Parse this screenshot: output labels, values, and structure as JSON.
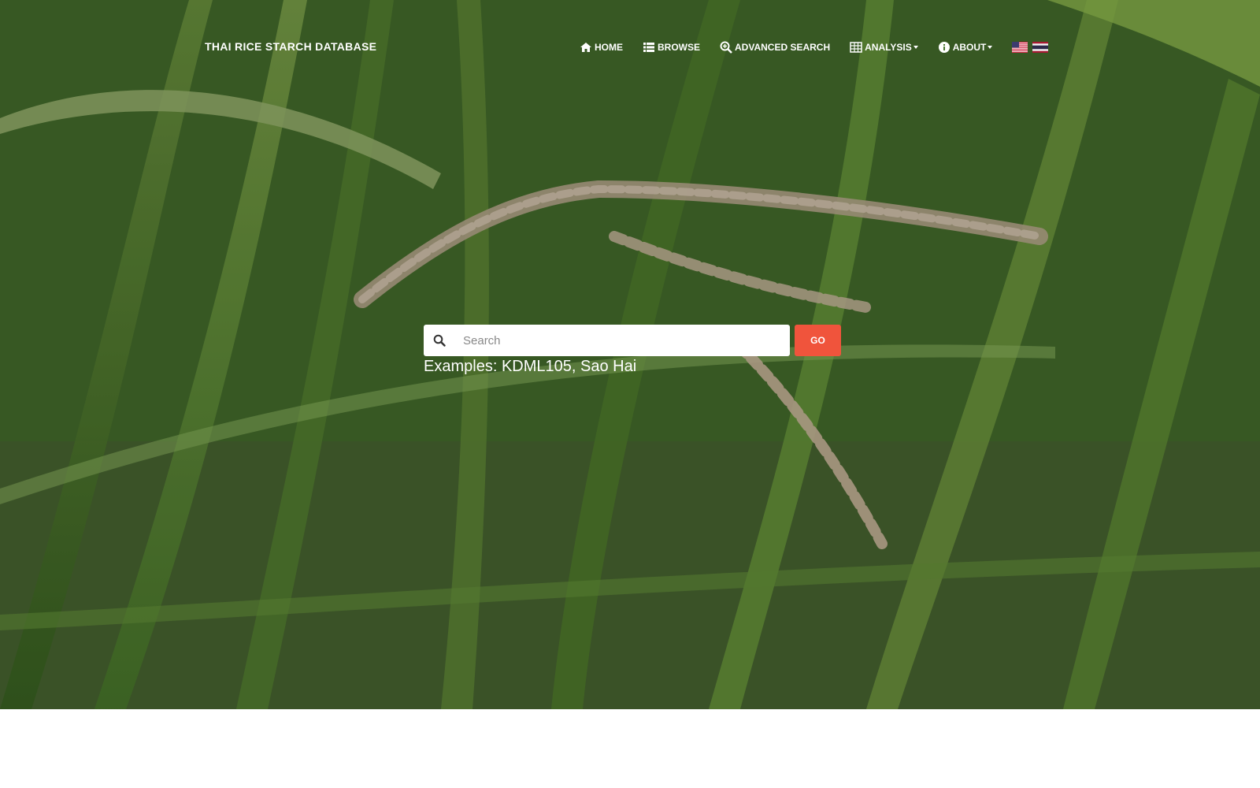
{
  "navbar": {
    "brand": "THAI RICE STARCH DATABASE",
    "items": [
      {
        "label": "HOME",
        "icon": "home-icon"
      },
      {
        "label": "BROWSE",
        "icon": "list-icon"
      },
      {
        "label": "ADVANCED SEARCH",
        "icon": "search-plus-icon"
      },
      {
        "label": "ANALYSIS",
        "icon": "table-icon",
        "dropdown": true
      },
      {
        "label": "ABOUT",
        "icon": "info-icon",
        "dropdown": true
      }
    ],
    "languages": [
      {
        "icon": "us-flag-icon"
      },
      {
        "icon": "thai-flag-icon"
      }
    ]
  },
  "search": {
    "placeholder": "Search",
    "value": "",
    "button_label": "GO",
    "examples_prefix": "Examples: ",
    "examples": [
      "KDML105",
      "Sao Hai"
    ],
    "separator": ", "
  },
  "colors": {
    "accent": "#f0543c",
    "nav_text": "#ffffff",
    "page_background": "#ffffff"
  }
}
